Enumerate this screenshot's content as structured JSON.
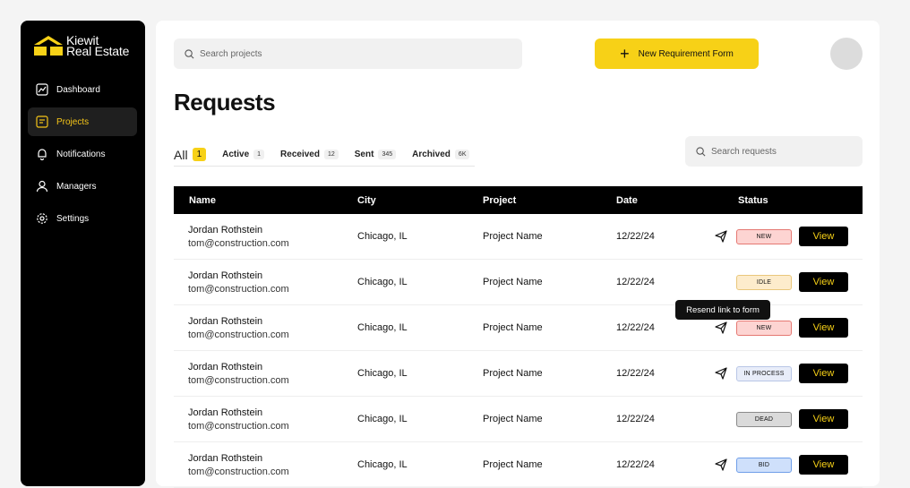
{
  "brand": {
    "line1": "Kiewit",
    "line2": "Real Estate",
    "accent": "#f7d117"
  },
  "sidebar": {
    "items": [
      {
        "label": "Dashboard",
        "icon": "chart-icon",
        "active": false
      },
      {
        "label": "Projects",
        "icon": "document-icon",
        "active": true
      },
      {
        "label": "Notifications",
        "icon": "bell-icon",
        "active": false
      },
      {
        "label": "Managers",
        "icon": "user-icon",
        "active": false
      },
      {
        "label": "Settings",
        "icon": "gear-icon",
        "active": false
      }
    ]
  },
  "header": {
    "search_placeholder": "Search projects",
    "new_button_label": "New Requirement Form"
  },
  "page": {
    "title": "Requests"
  },
  "tabs": [
    {
      "label": "All",
      "count": "1"
    },
    {
      "label": "Active",
      "count": "1"
    },
    {
      "label": "Received",
      "count": "12"
    },
    {
      "label": "Sent",
      "count": "345"
    },
    {
      "label": "Archived",
      "count": "6K"
    }
  ],
  "requests_search_placeholder": "Search requests",
  "table": {
    "headers": {
      "name": "Name",
      "city": "City",
      "project": "Project",
      "date": "Date",
      "status": "Status"
    },
    "view_label": "View",
    "rows": [
      {
        "name": "Jordan Rothstein",
        "email": "tom@construction.com",
        "city": "Chicago, IL",
        "project": "Project Name",
        "date": "12/22/24",
        "status": "NEW",
        "send": true
      },
      {
        "name": "Jordan Rothstein",
        "email": "tom@construction.com",
        "city": "Chicago, IL",
        "project": "Project Name",
        "date": "12/22/24",
        "status": "IDLE",
        "send": false
      },
      {
        "name": "Jordan Rothstein",
        "email": "tom@construction.com",
        "city": "Chicago, IL",
        "project": "Project Name",
        "date": "12/22/24",
        "status": "NEW",
        "send": true
      },
      {
        "name": "Jordan Rothstein",
        "email": "tom@construction.com",
        "city": "Chicago, IL",
        "project": "Project Name",
        "date": "12/22/24",
        "status": "IN PROCESS",
        "send": true
      },
      {
        "name": "Jordan Rothstein",
        "email": "tom@construction.com",
        "city": "Chicago, IL",
        "project": "Project Name",
        "date": "12/22/24",
        "status": "DEAD",
        "send": false
      },
      {
        "name": "Jordan Rothstein",
        "email": "tom@construction.com",
        "city": "Chicago, IL",
        "project": "Project Name",
        "date": "12/22/24",
        "status": "BID",
        "send": true
      }
    ]
  },
  "status_colors": {
    "NEW": {
      "bg": "#fdd4d2",
      "border": "#e57872"
    },
    "IDLE": {
      "bg": "#fdeccc",
      "border": "#e9c77b"
    },
    "IN PROCESS": {
      "bg": "#e8edf9",
      "border": "#b9c6e6"
    },
    "DEAD": {
      "bg": "#dadada",
      "border": "#8a8a8a"
    },
    "BID": {
      "bg": "#cfe0fb",
      "border": "#6f9ee8"
    }
  },
  "tooltip": {
    "text": "Resend link to form"
  }
}
